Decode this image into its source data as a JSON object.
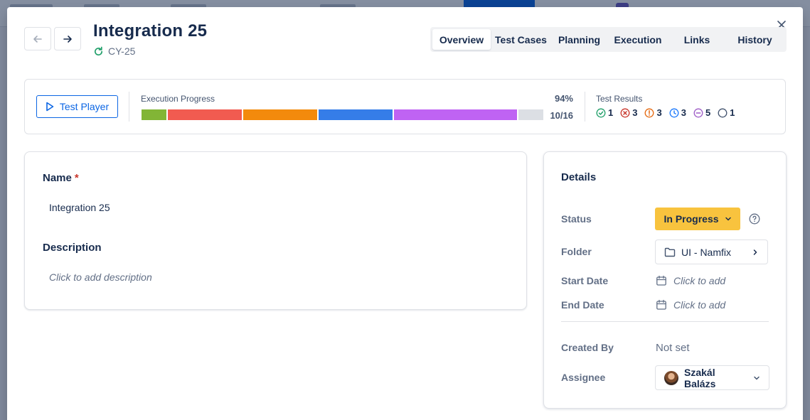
{
  "modal": {
    "title": "Integration 25",
    "issue_key": "CY-25",
    "close_icon": "close-icon"
  },
  "tabs": [
    {
      "label": "Overview",
      "active": true
    },
    {
      "label": "Test Cases",
      "active": false
    },
    {
      "label": "Planning",
      "active": false
    },
    {
      "label": "Execution",
      "active": false
    },
    {
      "label": "Links",
      "active": false
    },
    {
      "label": "History",
      "active": false
    }
  ],
  "execution": {
    "player_label": "Test Player",
    "progress_label": "Execution Progress",
    "percent": "94%",
    "count": "10/16",
    "segments": [
      {
        "status": "passed",
        "color": "#82b536",
        "fraction": 0.0625
      },
      {
        "status": "failed",
        "color": "#f15b50",
        "fraction": 0.1875
      },
      {
        "status": "aborted",
        "color": "#f38a0c",
        "fraction": 0.1875
      },
      {
        "status": "executing",
        "color": "#357de8",
        "fraction": 0.1875
      },
      {
        "status": "blocked",
        "color": "#bf63f3",
        "fraction": 0.3125
      },
      {
        "status": "todo",
        "color": "#dcdfe4",
        "fraction": 0.0625
      }
    ],
    "results_label": "Test Results",
    "results": [
      {
        "icon": "check-circle-icon",
        "color": "#22a06b",
        "count": "1"
      },
      {
        "icon": "x-circle-icon",
        "color": "#c9372c",
        "count": "3"
      },
      {
        "icon": "alert-circle-icon",
        "color": "#e56910",
        "count": "3"
      },
      {
        "icon": "clock-circle-icon",
        "color": "#1d7afc",
        "count": "3"
      },
      {
        "icon": "minus-circle-icon",
        "color": "#9f5ec7",
        "count": "5"
      },
      {
        "icon": "empty-circle-icon",
        "color": "#44546f",
        "count": "1"
      }
    ]
  },
  "form": {
    "name_label": "Name",
    "required_marker": "*",
    "name_value": "Integration 25",
    "description_label": "Description",
    "description_placeholder": "Click to add description"
  },
  "details": {
    "title": "Details",
    "status_label": "Status",
    "status_value": "In Progress",
    "status_color": "#f8c33e",
    "folder_label": "Folder",
    "folder_value": "UI - Namfix",
    "start_date_label": "Start Date",
    "start_date_placeholder": "Click to add",
    "end_date_label": "End Date",
    "end_date_placeholder": "Click to add",
    "created_by_label": "Created By",
    "created_by_value": "Not set",
    "assignee_label": "Assignee",
    "assignee_value": "Szakál Balázs"
  }
}
